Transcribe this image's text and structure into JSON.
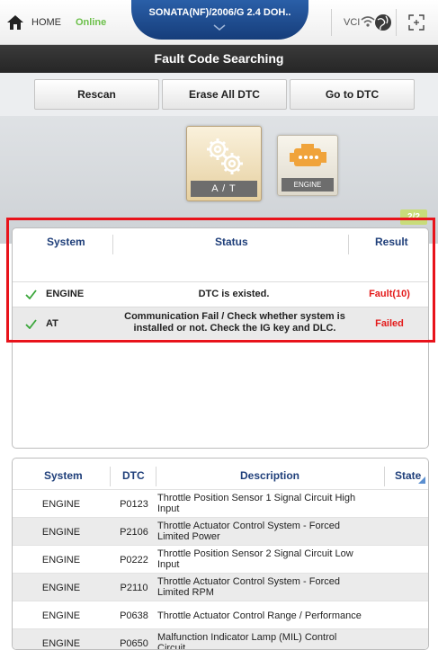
{
  "topbar": {
    "home_label": "HOME",
    "online_label": "Online",
    "vehicle_title": "SONATA(NF)/2006/G 2.4 DOH..",
    "vci_label": "VCI"
  },
  "title": "Fault Code Searching",
  "toolbar": {
    "rescan_label": "Rescan",
    "erase_label": "Erase All DTC",
    "goto_label": "Go to DTC"
  },
  "modules": {
    "at_label": "A / T",
    "engine_label": "ENGINE",
    "page_count": "2/2",
    "progress": 1.0
  },
  "result_table": {
    "headers": {
      "system": "System",
      "status": "Status",
      "result": "Result"
    },
    "rows": [
      {
        "system": "ENGINE",
        "status": "DTC is existed.",
        "result": "Fault(10)"
      },
      {
        "system": "AT",
        "status_line1": "Communication Fail / Check whether system is",
        "status_line2": "installed or not. Check the IG key and DLC.",
        "result": "Failed"
      }
    ]
  },
  "dtc_table": {
    "headers": {
      "system": "System",
      "dtc": "DTC",
      "description": "Description",
      "state": "State"
    },
    "rows": [
      {
        "system": "ENGINE",
        "dtc": "P0123",
        "desc1": "Throttle Position Sensor 1 Signal Circuit High",
        "desc2": "Input"
      },
      {
        "system": "ENGINE",
        "dtc": "P2106",
        "desc1": "Throttle Actuator Control System - Forced",
        "desc2": "Limited Power"
      },
      {
        "system": "ENGINE",
        "dtc": "P0222",
        "desc1": "Throttle Position Sensor 2 Signal Circuit Low",
        "desc2": "Input"
      },
      {
        "system": "ENGINE",
        "dtc": "P2110",
        "desc1": "Throttle Actuator Control System - Forced",
        "desc2": "Limited RPM"
      },
      {
        "system": "ENGINE",
        "dtc": "P0638",
        "desc1": "Throttle Actuator Control Range / Performance",
        "desc2": ""
      },
      {
        "system": "ENGINE",
        "dtc": "P0650",
        "desc1": "Malfunction Indicator Lamp (MIL) Control",
        "desc2": "Circuit"
      }
    ]
  },
  "colors": {
    "header_blue": "#1f3f7a",
    "fault_red": "#e41b1b",
    "online_green": "#6cc04a",
    "highlight_red": "#e8131b"
  }
}
